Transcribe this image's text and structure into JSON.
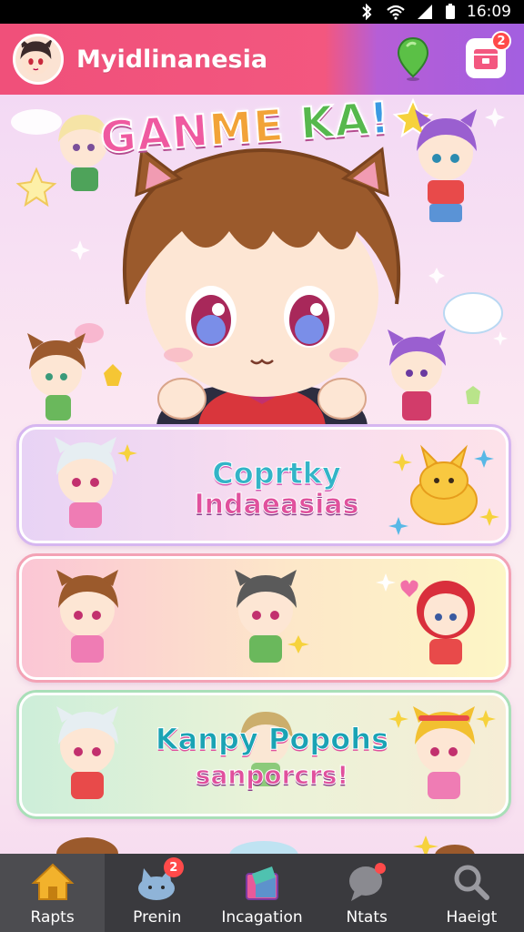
{
  "status_bar": {
    "time": "16:09"
  },
  "header": {
    "title": "Myidlinanesia",
    "store_badge": "2",
    "icons": [
      "avatar",
      "map-pin-icon",
      "store-icon"
    ]
  },
  "hero": {
    "title_parts": [
      "GAN",
      "ME",
      " KA",
      "!"
    ]
  },
  "cards": [
    {
      "line1": "Coprtky",
      "line2": "Indaeasias"
    },
    {
      "line1": "",
      "line2": ""
    },
    {
      "line1": "Kanpy Popohs",
      "line2": "sanporcrs!"
    }
  ],
  "nav": {
    "items": [
      {
        "label": "Rapts",
        "icon": "home-icon",
        "active": true
      },
      {
        "label": "Prenin",
        "icon": "cat-icon",
        "badge": "2"
      },
      {
        "label": "Incagation",
        "icon": "gift-icon"
      },
      {
        "label": "Ntats",
        "icon": "chat-icon"
      },
      {
        "label": "Haeigt",
        "icon": "search-icon"
      }
    ]
  },
  "colors": {
    "header_pink": "#f3577f",
    "header_purple": "#a35fe0",
    "nav_bg": "#3a3a3e",
    "nav_active": "#4c4c50",
    "home_icon": "#f2b22c"
  }
}
